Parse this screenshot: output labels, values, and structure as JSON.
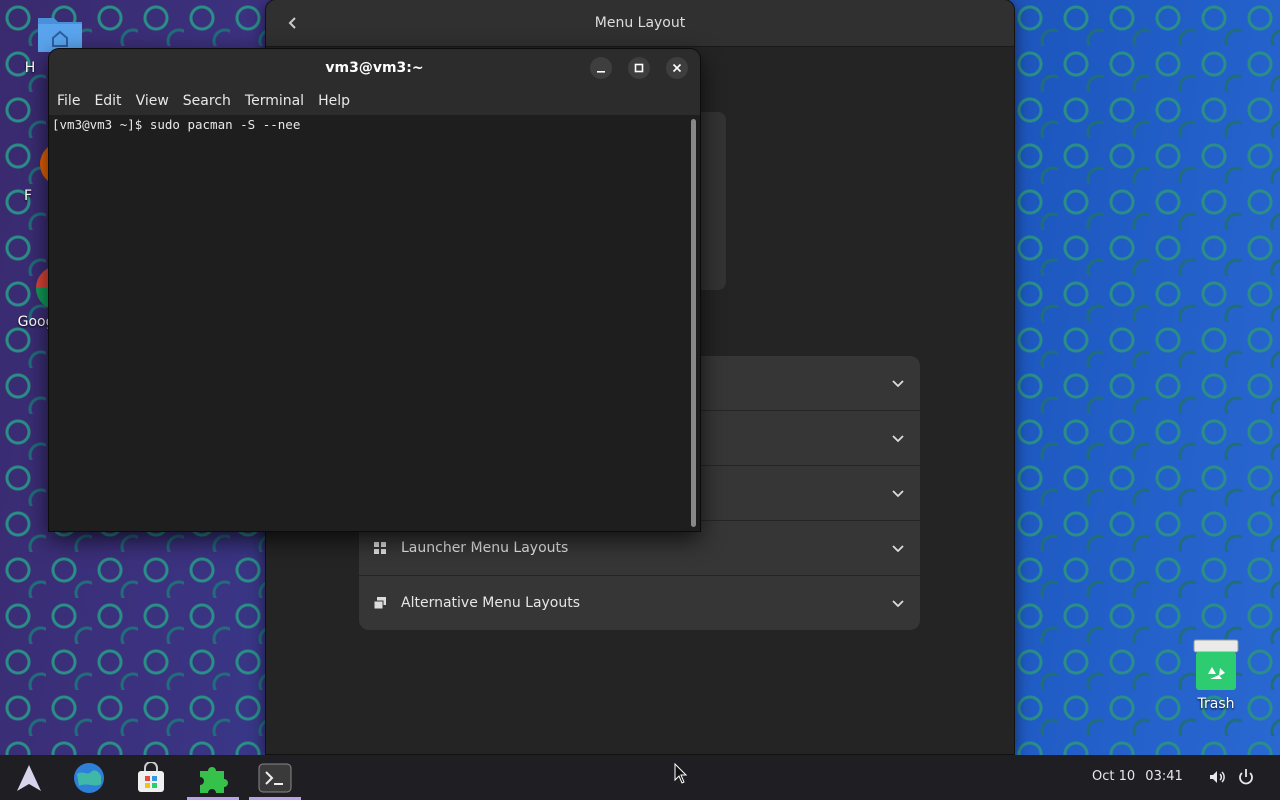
{
  "desktop": {
    "icons": [
      {
        "label": "H"
      },
      {
        "label": "F"
      },
      {
        "label": "Googl"
      },
      {
        "label": "Trash"
      }
    ]
  },
  "settings_window": {
    "title": "Menu Layout",
    "rows": [
      {
        "label": ""
      },
      {
        "label": ""
      },
      {
        "label": ""
      },
      {
        "label": "Launcher Menu Layouts"
      },
      {
        "label": "Alternative Menu Layouts"
      }
    ]
  },
  "terminal": {
    "title": "vm3@vm3:~",
    "menu": [
      "File",
      "Edit",
      "View",
      "Search",
      "Terminal",
      "Help"
    ],
    "prompt_line": "[vm3@vm3 ~]$ sudo pacman -S --nee"
  },
  "taskbar": {
    "date": "Oct 10",
    "time": "03:41",
    "items": [
      "arch-menu",
      "browser",
      "software-store",
      "extensions",
      "terminal"
    ],
    "active_items": [
      "extensions",
      "terminal"
    ]
  },
  "colors": {
    "accent": "#b8a4e6",
    "terminal_bg": "#1e1e1e",
    "window_bg": "#242424"
  }
}
